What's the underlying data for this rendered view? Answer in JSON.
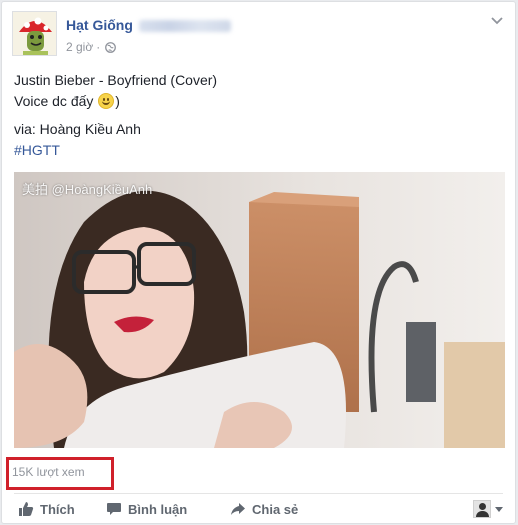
{
  "post": {
    "author_name": "Hạt Giống",
    "timestamp": "2 giờ",
    "privacy_icon": "globe-icon",
    "lines": {
      "title": "Justin Bieber - Boyfriend (Cover)",
      "voice_prefix": "Voice dc đấy",
      "voice_suffix": ")",
      "via": "via: Hoàng Kiều Anh",
      "hashtag": "#HGTT"
    },
    "video": {
      "watermark": "美拍 @HoàngKiềuAnh"
    },
    "views": "15K lượt xem",
    "actions": {
      "like": "Thích",
      "comment": "Bình luận",
      "share": "Chia sẻ"
    },
    "colors": {
      "link": "#365899",
      "highlight_box": "#d0202a",
      "muted": "#90949c"
    }
  }
}
